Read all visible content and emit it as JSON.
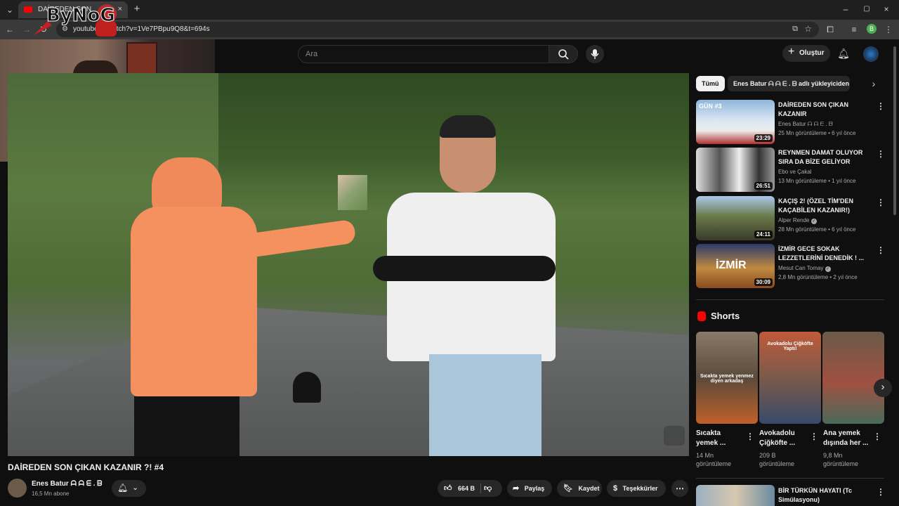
{
  "browser": {
    "tab_title": "DAİREDEN SON",
    "url": "youtube.c  /watch?v=1Ve7PBpu9Q8&t=694s",
    "overlay_logo_text": "ByNoG"
  },
  "header": {
    "search_placeholder": "Ara",
    "create_label": "Oluştur"
  },
  "video": {
    "title": "DAİREDEN SON ÇIKAN KAZANIR ?! #4",
    "channel_name": "Enes Batur ᗩ ᗩ ᗴ . ᗷ",
    "subscribers": "16,5 Mn abone",
    "likes": "664 B",
    "share_label": "Paylaş",
    "save_label": "Kaydet",
    "thanks_label": "Teşekkürler"
  },
  "sidebar": {
    "chips": [
      "Tümü",
      "Enes Batur ᗩ ᗩ ᗴ . ᗷ adlı yükleyiciden"
    ],
    "recommendations": [
      {
        "title_line1": "DAİREDEN SON ÇIKAN",
        "title_line2": "KAZANIR",
        "channel": "Enes Batur ᗩ ᗩ ᗴ . ᗷ",
        "meta": "25 Mn görüntüleme • 6 yıl önce",
        "duration": "23:29",
        "thumb_text": "GÜN #3"
      },
      {
        "title_line1": "REYNMEN DAMAT OLUYOR",
        "title_line2": "SIRA DA BİZE GELİYOR",
        "channel": "Ebo ve Çakal",
        "meta": "13 Mn görüntüleme • 1 yıl önce",
        "duration": "26:51",
        "thumb_text": ""
      },
      {
        "title_line1": "KAÇIŞ 2! (ÖZEL TİM'DEN",
        "title_line2": "KAÇABİLEN KAZANIR!)",
        "channel": "Alper Rende",
        "meta": "28 Mn görüntüleme • 6 yıl önce",
        "duration": "24:11",
        "thumb_text": ""
      },
      {
        "title_line1": "İZMİR GECE SOKAK",
        "title_line2": "LEZZETLERİNİ DENEDİK ! ...",
        "channel": "Mesut Can Tomay",
        "meta": "2,8 Mn görüntüleme • 2 yıl önce",
        "duration": "30:09",
        "thumb_text": "İZMİR"
      }
    ],
    "shorts_heading": "Shorts",
    "shorts": [
      {
        "title_line1": "Sıcakta",
        "title_line2": "yemek ...",
        "views_line1": "14 Mn",
        "views_line2": "görüntüleme",
        "caption": "Sıcakta yemek yenmez diyen arkadaş"
      },
      {
        "title_line1": "Avokadolu",
        "title_line2": "Çiğköfte ...",
        "views_line1": "209 B",
        "views_line2": "görüntüleme",
        "caption": "Avokadolu Çiğköfte Yaptı!"
      },
      {
        "title_line1": "Ana yemek",
        "title_line2": "dışında her ...",
        "views_line1": "9,8 Mn",
        "views_line2": "görüntüleme",
        "caption": ""
      }
    ],
    "next_rec_title_line1": "BİR TÜRKÜN HAYATI (Tc",
    "next_rec_title_line2": "Simülasyonu)"
  },
  "colors": {
    "background": "#0f0f0f",
    "youtube_red": "#ff0000",
    "chip_active": "#f1f1f1",
    "pill": "#272727"
  }
}
